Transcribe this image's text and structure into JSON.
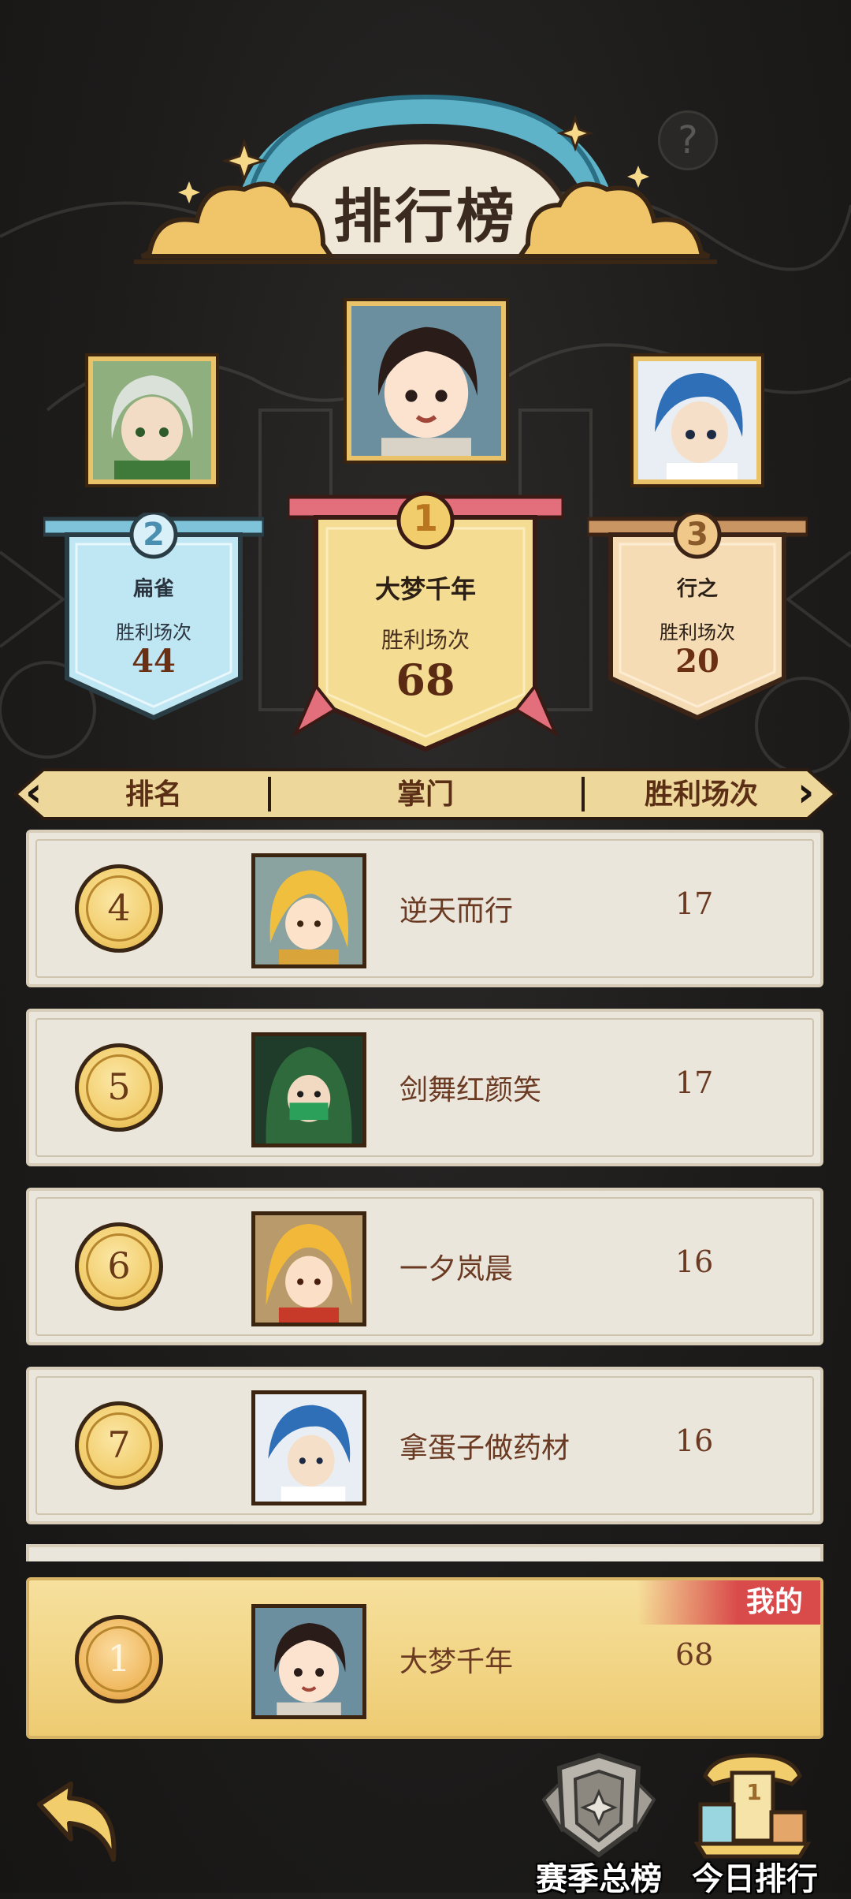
{
  "header": {
    "title": "排行榜",
    "help_symbol": "?"
  },
  "podium": [
    {
      "rank": "1",
      "name": "大梦千年",
      "stat_label": "胜利场次",
      "wins": "68",
      "color": "#f2d98e"
    },
    {
      "rank": "2",
      "name": "扁雀",
      "stat_label": "胜利场次",
      "wins": "44",
      "color": "#bfe6f3"
    },
    {
      "rank": "3",
      "name": "行之",
      "stat_label": "胜利场次",
      "wins": "20",
      "color": "#f3d7b1"
    }
  ],
  "list_header": {
    "rank": "排名",
    "name": "掌门",
    "wins": "胜利场次",
    "prev_icon": "chevron-left-icon",
    "next_icon": "chevron-right-icon"
  },
  "rows": [
    {
      "rank": "4",
      "name": "逆天而行",
      "wins": "17"
    },
    {
      "rank": "5",
      "name": "剑舞红颜笑",
      "wins": "17"
    },
    {
      "rank": "6",
      "name": "一夕岚晨",
      "wins": "16"
    },
    {
      "rank": "7",
      "name": "拿蛋子做药材",
      "wins": "16"
    }
  ],
  "my_rank": {
    "tag": "我的",
    "rank": "1",
    "name": "大梦千年",
    "wins": "68"
  },
  "bottom_nav": {
    "season_label": "赛季总榜",
    "today_label": "今日排行",
    "today_badge": "1",
    "back_icon": "back-arrow-icon"
  },
  "colors": {
    "background": "#1d1c1b",
    "gold": "#e9c26a",
    "accent_red": "#d94a4a",
    "text_brown": "#6b3a22"
  }
}
